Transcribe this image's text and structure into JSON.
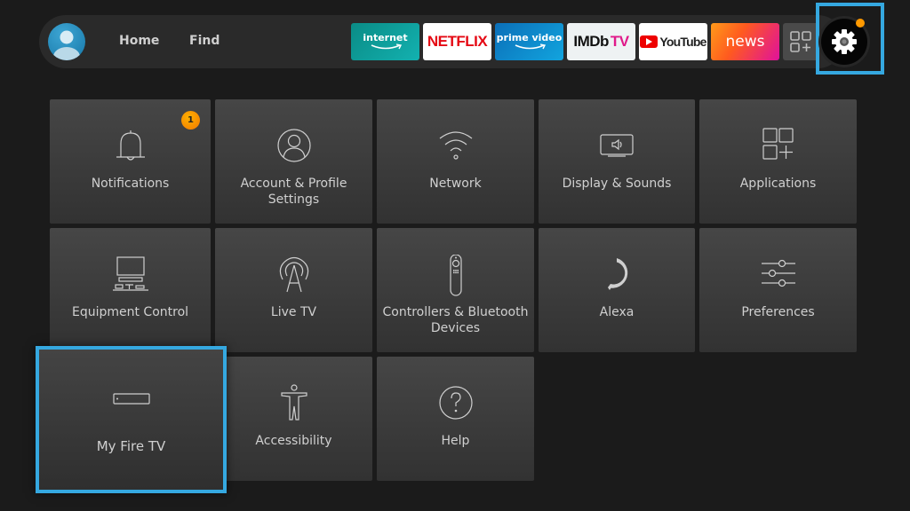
{
  "nav": {
    "avatar_icon": "profile-avatar",
    "links": [
      {
        "label": "Home"
      },
      {
        "label": "Find"
      }
    ]
  },
  "apps": [
    {
      "name": "internet",
      "label": "internet"
    },
    {
      "name": "netflix",
      "label": "NETFLIX"
    },
    {
      "name": "prime-video",
      "label": "prime video"
    },
    {
      "name": "imdb-tv",
      "label_main": "IMDb",
      "label_suffix": "TV"
    },
    {
      "name": "youtube",
      "label": "YouTube"
    },
    {
      "name": "news",
      "label": "news"
    },
    {
      "name": "all-apps",
      "icon": "grid-plus-icon"
    }
  ],
  "settings": {
    "icon": "gear-icon",
    "focused": true,
    "has_alert_dot": true,
    "alert_color": "#ff9900"
  },
  "accent_colors": {
    "focus_border": "#35a8e0",
    "badge": "#ff9900"
  },
  "tiles": [
    {
      "id": "notifications",
      "label": "Notifications",
      "icon": "bell-icon",
      "badge": "1"
    },
    {
      "id": "account",
      "label": "Account & Profile Settings",
      "icon": "person-circle-icon"
    },
    {
      "id": "network",
      "label": "Network",
      "icon": "wifi-icon"
    },
    {
      "id": "display",
      "label": "Display & Sounds",
      "icon": "display-sound-icon"
    },
    {
      "id": "applications",
      "label": "Applications",
      "icon": "apps-icon"
    },
    {
      "id": "equipment",
      "label": "Equipment Control",
      "icon": "tv-equipment-icon"
    },
    {
      "id": "livetv",
      "label": "Live TV",
      "icon": "antenna-icon"
    },
    {
      "id": "controllers",
      "label": "Controllers & Bluetooth Devices",
      "icon": "remote-icon"
    },
    {
      "id": "alexa",
      "label": "Alexa",
      "icon": "alexa-icon"
    },
    {
      "id": "preferences",
      "label": "Preferences",
      "icon": "sliders-icon"
    },
    {
      "id": "myfiretv",
      "label": "My Fire TV",
      "icon": "fire-tv-device-icon",
      "focused": true
    },
    {
      "id": "accessibility",
      "label": "Accessibility",
      "icon": "accessibility-icon"
    },
    {
      "id": "help",
      "label": "Help",
      "icon": "help-icon"
    }
  ]
}
